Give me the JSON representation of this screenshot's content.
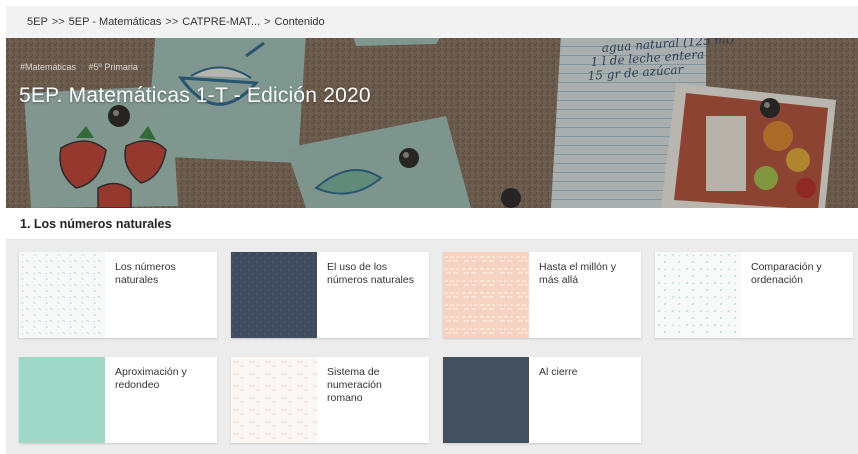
{
  "breadcrumb": {
    "items": [
      "5EP",
      "5EP - Matemáticas",
      "CATPRE-MAT...",
      "Contenido"
    ],
    "separators": [
      ">>",
      ">>",
      ">"
    ]
  },
  "course": {
    "tags": [
      "#Matemáticas",
      "#5º Primaria"
    ],
    "title": "5EP. Matemáticas 1-T - Edición 2020",
    "note_lines": [
      "agua natural (125 ml)",
      "1 l de leche entera",
      "15 gr de azúcar"
    ]
  },
  "section": {
    "title": "1. Los números naturales"
  },
  "cards": [
    {
      "label": "Los números naturales",
      "thumb": "light-pattern"
    },
    {
      "label": "El uso de los números naturales",
      "thumb": "navy-dots"
    },
    {
      "label": "Hasta el millón y más allá",
      "thumb": "peach-text"
    },
    {
      "label": "Comparación y ordenación",
      "thumb": "light-mint"
    },
    {
      "label": "Aproximación y redondeo",
      "thumb": "solid-mint"
    },
    {
      "label": "Sistema de numeración romano",
      "thumb": "light-cream"
    },
    {
      "label": "Al cierre",
      "thumb": "solid-slate"
    }
  ],
  "colors": {
    "mint": "#9fd8c6",
    "slate": "#46515f",
    "navy": "#3f4c5d",
    "peach": "#f6d2c2"
  }
}
